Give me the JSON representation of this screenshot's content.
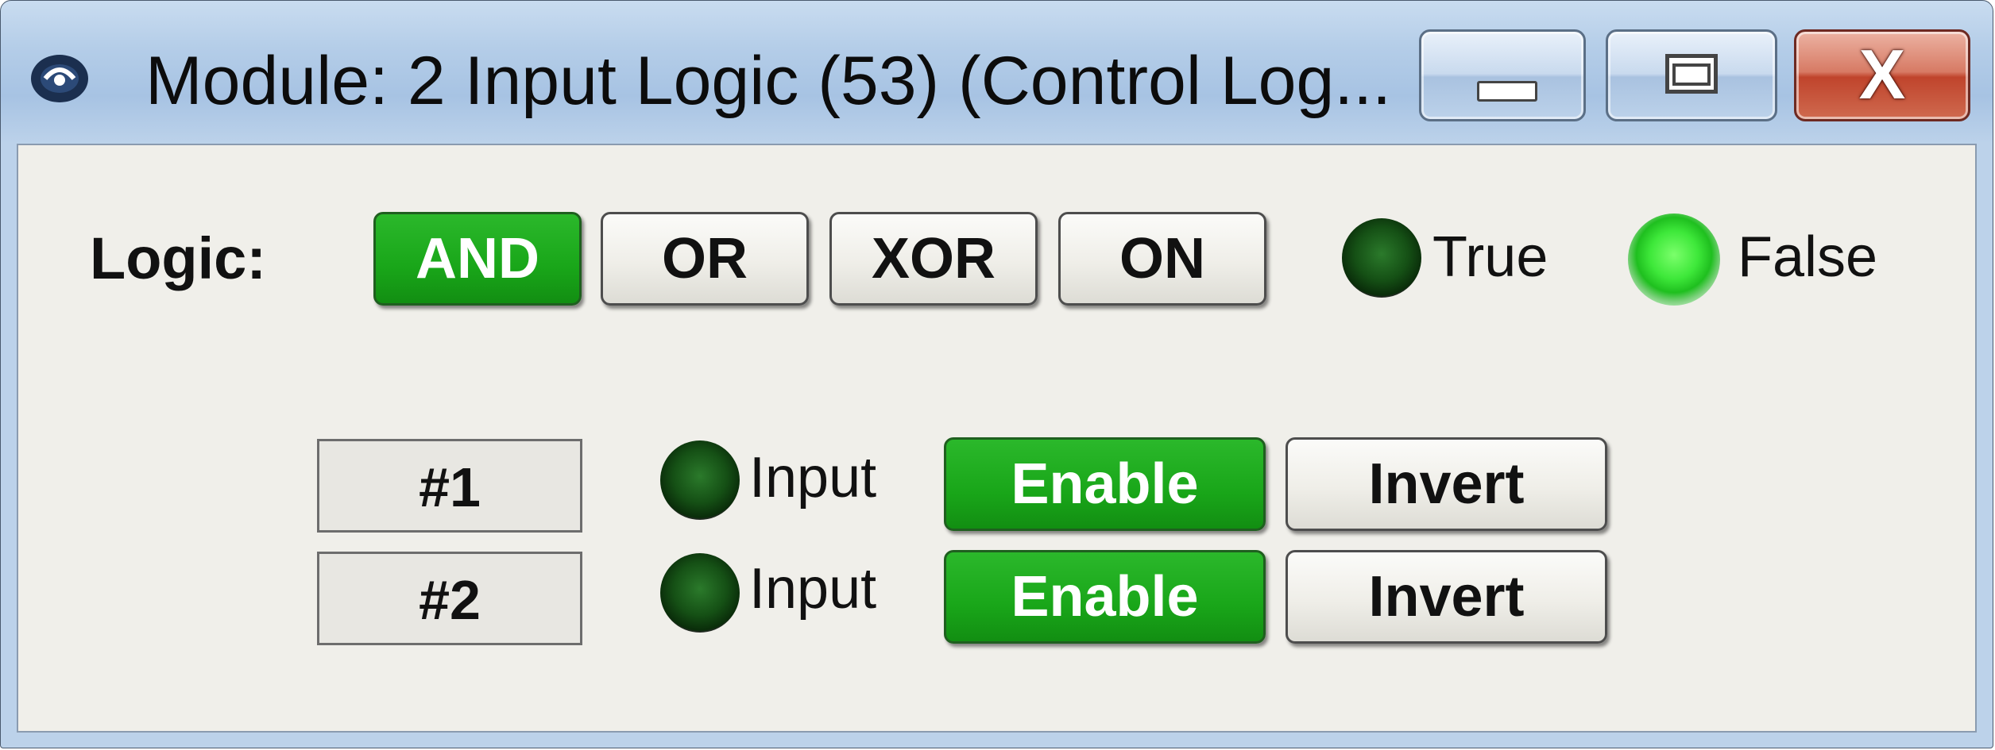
{
  "window": {
    "title": "Module: 2 Input Logic (53) (Control Log...",
    "close_glyph": "X"
  },
  "logic": {
    "label": "Logic:",
    "modes": [
      {
        "label": "AND",
        "active": true
      },
      {
        "label": "OR",
        "active": false
      },
      {
        "label": "XOR",
        "active": false
      },
      {
        "label": "ON",
        "active": false
      }
    ],
    "outputs": [
      {
        "label": "True",
        "lit": false
      },
      {
        "label": "False",
        "lit": true
      }
    ]
  },
  "inputs": [
    {
      "number": "#1",
      "led_label": "Input",
      "enable_label": "Enable",
      "enable_active": true,
      "invert_label": "Invert"
    },
    {
      "number": "#2",
      "led_label": "Input",
      "enable_label": "Enable",
      "enable_active": true,
      "invert_label": "Invert"
    }
  ],
  "colors": {
    "active_green": "#19a619",
    "led_lit": "#3ee83a",
    "led_dark": "#155015",
    "close_red": "#c0442c"
  }
}
